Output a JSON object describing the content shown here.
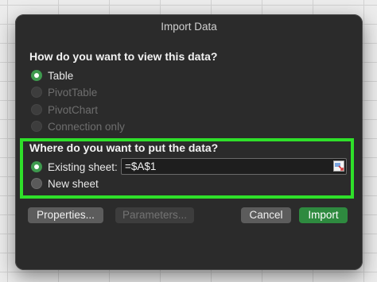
{
  "dialog": {
    "title": "Import Data"
  },
  "view_section": {
    "question": "How do you want to view this data?",
    "options": [
      {
        "label": "Table",
        "state": "selected"
      },
      {
        "label": "PivotTable",
        "state": "disabled"
      },
      {
        "label": "PivotChart",
        "state": "disabled"
      },
      {
        "label": "Connection only",
        "state": "disabled"
      }
    ]
  },
  "put_section": {
    "question": "Where do you want to put the data?",
    "existing_sheet_label": "Existing sheet:",
    "reference_value": "=$A$1",
    "new_sheet_label": "New sheet",
    "selected": "existing_sheet"
  },
  "buttons": {
    "properties": "Properties...",
    "parameters": "Parameters...",
    "cancel": "Cancel",
    "import": "Import"
  },
  "colors": {
    "accent_green": "#2e8a3f",
    "highlight_green": "#2fe02a",
    "dialog_bg": "#2b2b2b"
  }
}
